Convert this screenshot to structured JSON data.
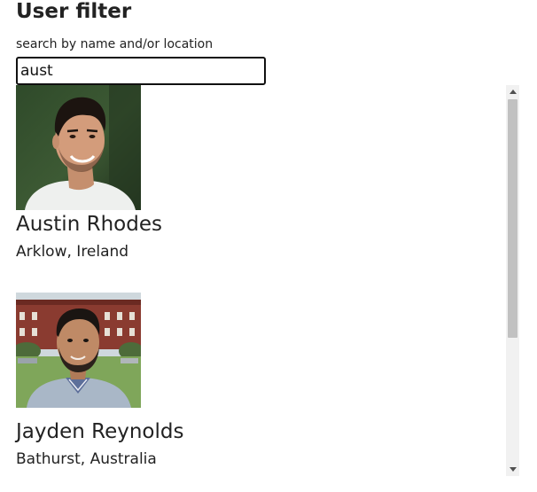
{
  "header": {
    "title": "User filter"
  },
  "search": {
    "label": "search by name and/or location",
    "value": "aust",
    "placeholder": ""
  },
  "results": [
    {
      "name": "Austin Rhodes",
      "location": "Arklow, Ireland",
      "photo_icon": "user-photo"
    },
    {
      "name": "Jayden Reynolds",
      "location": "Bathurst, Australia",
      "photo_icon": "user-photo"
    }
  ],
  "colors": {
    "text": "#222222",
    "input_border": "#111111",
    "scrollbar_track": "#f1f1f1",
    "scrollbar_thumb": "#c1c1c1"
  }
}
